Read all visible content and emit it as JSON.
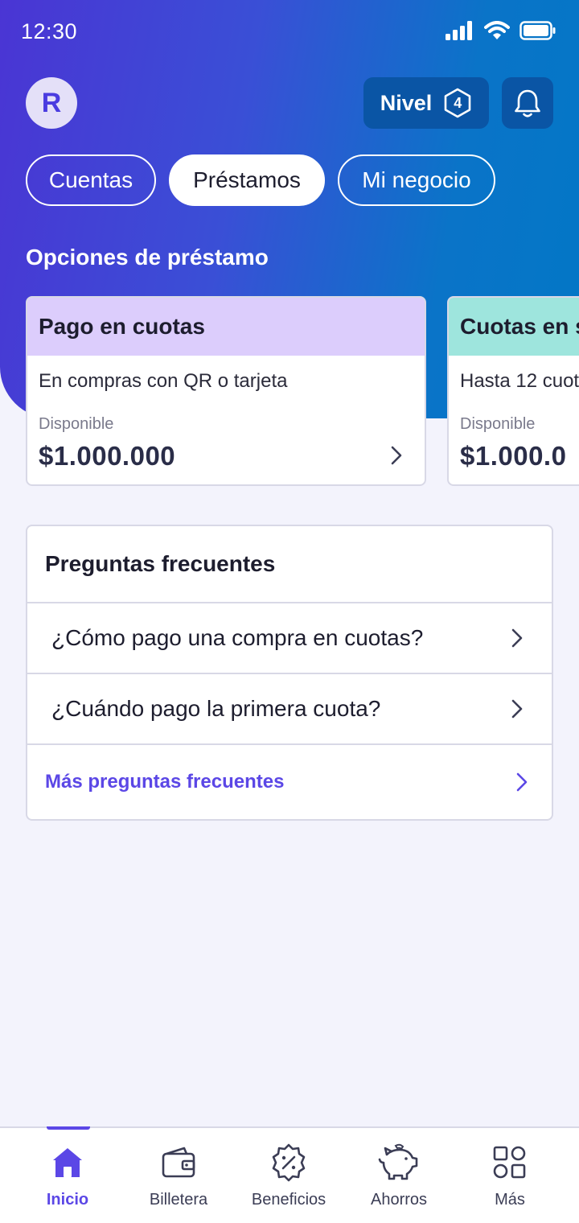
{
  "status_bar": {
    "time": "12:30"
  },
  "header": {
    "avatar_initial": "R",
    "level_label": "Nivel",
    "level_value": "4"
  },
  "tabs": [
    {
      "label": "Cuentas",
      "active": false
    },
    {
      "label": "Préstamos",
      "active": true
    },
    {
      "label": "Mi negocio",
      "active": false
    }
  ],
  "loan_options": {
    "title": "Opciones de préstamo",
    "cards": [
      {
        "title": "Pago en cuotas",
        "subtitle": "En compras con QR o tarjeta",
        "available_label": "Disponible",
        "amount": "$1.000.000",
        "header_color": "#dccdfc"
      },
      {
        "title": "Cuotas en s",
        "subtitle": "Hasta 12 cuot",
        "available_label": "Disponible",
        "amount": "$1.000.0",
        "header_color": "#9ee5dd"
      }
    ]
  },
  "faq": {
    "title": "Preguntas frecuentes",
    "items": [
      {
        "label": "¿Cómo pago una compra en cuotas?"
      },
      {
        "label": "¿Cuándo pago la primera cuota?"
      }
    ],
    "more_label": "Más preguntas frecuentes"
  },
  "bottom_nav": {
    "items": [
      {
        "label": "Inicio",
        "icon": "home-icon",
        "active": true
      },
      {
        "label": "Billetera",
        "icon": "wallet-icon",
        "active": false
      },
      {
        "label": "Beneficios",
        "icon": "discount-badge-icon",
        "active": false
      },
      {
        "label": "Ahorros",
        "icon": "piggy-bank-icon",
        "active": false
      },
      {
        "label": "Más",
        "icon": "grid-icon",
        "active": false
      }
    ]
  },
  "colors": {
    "accent": "#5b47e6",
    "header_gradient_start": "#4a35d4",
    "header_gradient_end": "#0277c6",
    "page_background": "#f3f3fc"
  }
}
